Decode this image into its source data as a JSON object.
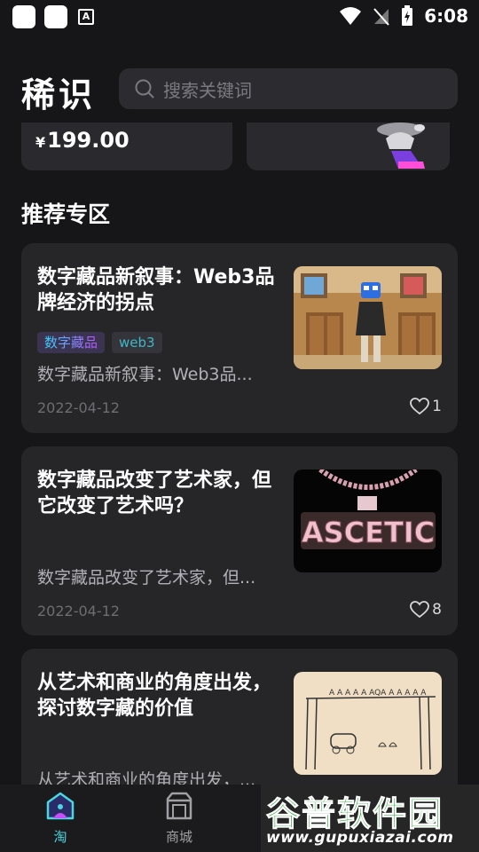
{
  "status_bar": {
    "time": "6:08"
  },
  "header": {
    "logo": "稀识",
    "search_placeholder": "搜索关键词"
  },
  "promo": {
    "price_symbol": "¥",
    "price": "199.00"
  },
  "section": {
    "title": "推荐专区"
  },
  "articles": [
    {
      "title": "数字藏品新叙事：Web3品牌经济的拐点",
      "tags": [
        "数字藏品",
        "web3"
      ],
      "desc": "数字藏品新叙事：Web3品...",
      "date": "2022-04-12",
      "likes": "1"
    },
    {
      "title": "数字藏品改变了艺术家，但它改变了艺术吗？",
      "tags": [],
      "desc": "数字藏品改变了艺术家，但...",
      "date": "2022-04-12",
      "likes": "8"
    },
    {
      "title": "从艺术和商业的角度出发，探讨数字藏的价值",
      "tags": [],
      "desc": "从艺术和商业的角度出发，...",
      "date": "",
      "likes": ""
    }
  ],
  "nav": {
    "home": "淘",
    "mall": "商城"
  },
  "watermark": {
    "big": "谷普软件园",
    "small": "www.gupuxiazai.com"
  },
  "colors": {
    "accent": "#49d7e0",
    "background": "#161618",
    "card": "#262629"
  }
}
